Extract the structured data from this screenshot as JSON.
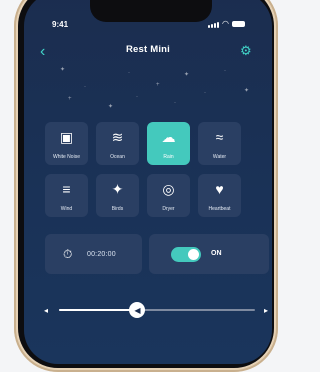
{
  "status": {
    "time": "9:41"
  },
  "header": {
    "title": "Rest Mini",
    "back_icon": "chevron-left-icon",
    "settings_icon": "gear-icon",
    "accent": "#41d3c8"
  },
  "sounds": [
    {
      "label": "White Noise",
      "icon": "tv-icon",
      "glyph": "📺",
      "active": false
    },
    {
      "label": "Ocean",
      "icon": "wave-icon",
      "glyph": "≋",
      "active": false
    },
    {
      "label": "Rain",
      "icon": "rain-cloud-icon",
      "glyph": "☂",
      "active": true
    },
    {
      "label": "Water",
      "icon": "water-icon",
      "glyph": "≈",
      "active": false
    },
    {
      "label": "Wind",
      "icon": "wind-icon",
      "glyph": "≡",
      "active": false
    },
    {
      "label": "Birds",
      "icon": "bird-icon",
      "glyph": "✦",
      "active": false
    },
    {
      "label": "Dryer",
      "icon": "dryer-icon",
      "glyph": "◎",
      "active": false
    },
    {
      "label": "Heartbeat",
      "icon": "heart-icon",
      "glyph": "♥",
      "active": false
    }
  ],
  "timer": {
    "value": "00:20:00",
    "icon": "stopwatch-icon"
  },
  "power": {
    "label": "ON",
    "state": true
  },
  "volume": {
    "level": 0.4,
    "left_icon": "volume-down-icon",
    "right_icon": "volume-up-icon",
    "knob_icon": "speaker-icon"
  },
  "colors": {
    "background": "#1b2d4f",
    "tile": "#2a3f63",
    "active": "#44c9bd"
  }
}
